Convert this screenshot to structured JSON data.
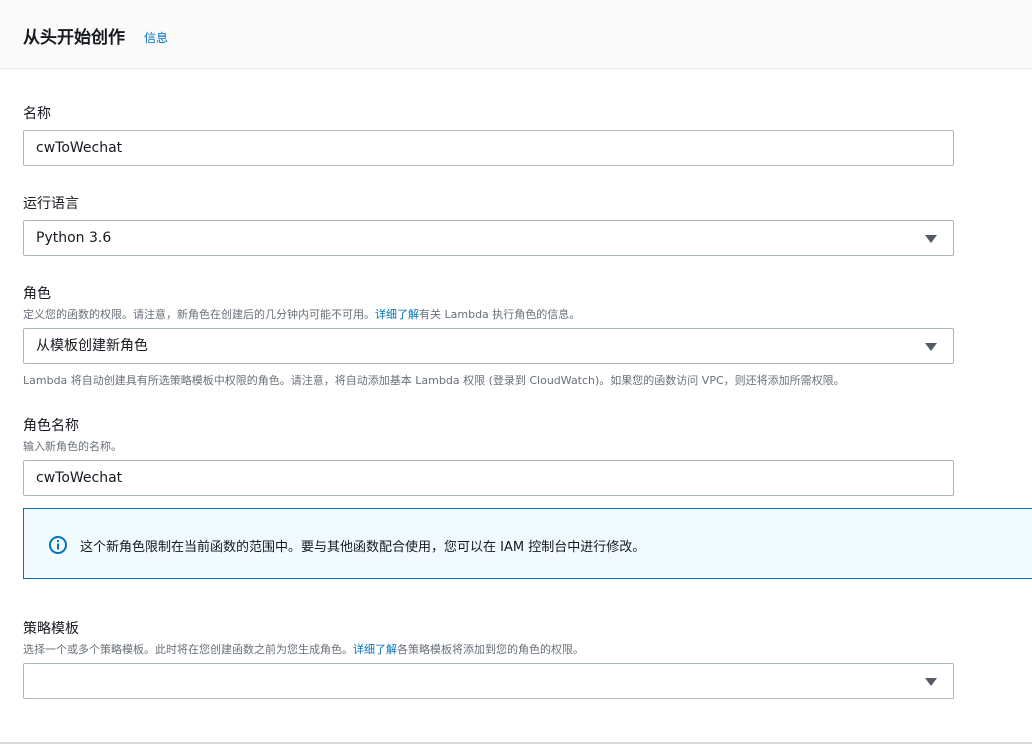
{
  "header": {
    "title": "从头开始创作",
    "info_link": "信息"
  },
  "name_field": {
    "label": "名称",
    "value": "cwToWechat"
  },
  "runtime_field": {
    "label": "运行语言",
    "selected": "Python 3.6"
  },
  "role_field": {
    "label": "角色",
    "description_before": "定义您的函数的权限。请注意，新角色在创建后的几分钟内可能不可用。",
    "description_link": "详细了解",
    "description_after": "有关 Lambda 执行角色的信息。",
    "selected": "从模板创建新角色",
    "help_text": "Lambda 将自动创建具有所选策略模板中权限的角色。请注意，将自动添加基本 Lambda 权限 (登录到 CloudWatch)。如果您的函数访问 VPC，则还将添加所需权限。"
  },
  "role_name_field": {
    "label": "角色名称",
    "description": "输入新角色的名称。",
    "value": "cwToWechat"
  },
  "info_alert": {
    "icon": "info-icon",
    "text": "这个新角色限制在当前函数的范围中。要与其他函数配合使用，您可以在 IAM 控制台中进行修改。"
  },
  "policy_templates_field": {
    "label": "策略模板",
    "description_before": "选择一个或多个策略模板。此时将在您创建函数之前为您生成角色。",
    "description_link": "详细了解",
    "description_after": "各策略模板将添加到您的角色的权限。",
    "selected": ""
  },
  "colors": {
    "link": "#0073bb",
    "alert_border": "#0073bb",
    "alert_bg": "#f1faff"
  }
}
